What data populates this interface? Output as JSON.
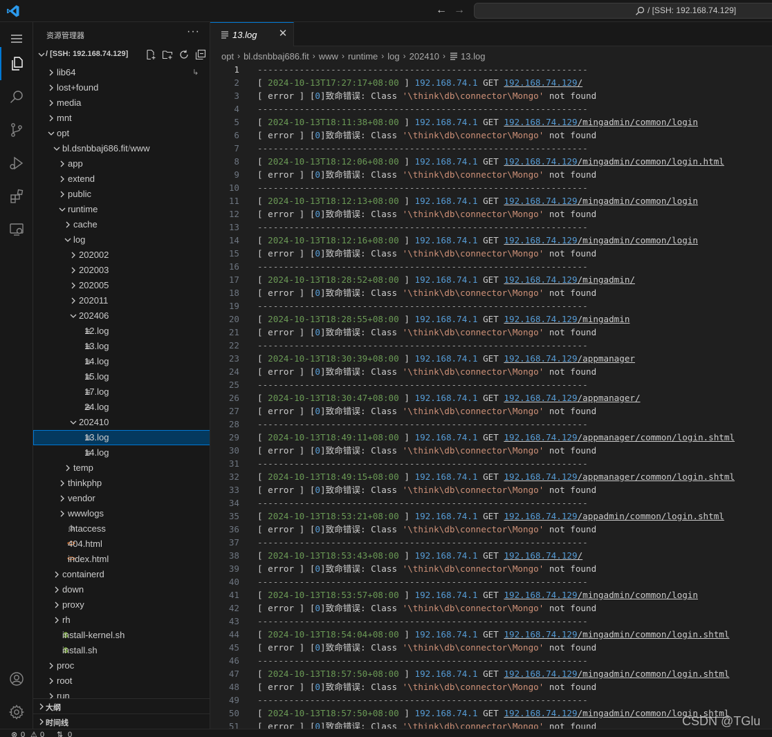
{
  "window": {
    "command_center_text": "/ [SSH: 192.168.74.129]"
  },
  "sidebar": {
    "title": "资源管理器",
    "section_title": "/ [SSH: 192.168.74.129]",
    "outline_title": "大纲",
    "timeline_title": "时间线",
    "tree": [
      {
        "label": "lib64",
        "depth": 0,
        "kind": "folder",
        "open": false,
        "badge": "↳"
      },
      {
        "label": "lost+found",
        "depth": 0,
        "kind": "folder",
        "open": false
      },
      {
        "label": "media",
        "depth": 0,
        "kind": "folder",
        "open": false
      },
      {
        "label": "mnt",
        "depth": 0,
        "kind": "folder",
        "open": false
      },
      {
        "label": "opt",
        "depth": 0,
        "kind": "folder",
        "open": true
      },
      {
        "label": "bl.dsnbbaj686.fit",
        "label2": "www",
        "depth": 1,
        "kind": "folder",
        "open": true
      },
      {
        "label": "app",
        "depth": 2,
        "kind": "folder",
        "open": false
      },
      {
        "label": "extend",
        "depth": 2,
        "kind": "folder",
        "open": false
      },
      {
        "label": "public",
        "depth": 2,
        "kind": "folder",
        "open": false
      },
      {
        "label": "runtime",
        "depth": 2,
        "kind": "folder",
        "open": true
      },
      {
        "label": "cache",
        "depth": 3,
        "kind": "folder",
        "open": false
      },
      {
        "label": "log",
        "depth": 3,
        "kind": "folder",
        "open": true
      },
      {
        "label": "202002",
        "depth": 4,
        "kind": "folder",
        "open": false
      },
      {
        "label": "202003",
        "depth": 4,
        "kind": "folder",
        "open": false
      },
      {
        "label": "202005",
        "depth": 4,
        "kind": "folder",
        "open": false
      },
      {
        "label": "202011",
        "depth": 4,
        "kind": "folder",
        "open": false
      },
      {
        "label": "202406",
        "depth": 4,
        "kind": "folder",
        "open": true
      },
      {
        "label": "12.log",
        "depth": 5,
        "kind": "log"
      },
      {
        "label": "13.log",
        "depth": 5,
        "kind": "log"
      },
      {
        "label": "14.log",
        "depth": 5,
        "kind": "log"
      },
      {
        "label": "15.log",
        "depth": 5,
        "kind": "log"
      },
      {
        "label": "17.log",
        "depth": 5,
        "kind": "log"
      },
      {
        "label": "24.log",
        "depth": 5,
        "kind": "log"
      },
      {
        "label": "202410",
        "depth": 4,
        "kind": "folder",
        "open": true
      },
      {
        "label": "13.log",
        "depth": 5,
        "kind": "log",
        "selected": true
      },
      {
        "label": "14.log",
        "depth": 5,
        "kind": "log"
      },
      {
        "label": "temp",
        "depth": 3,
        "kind": "folder",
        "open": false
      },
      {
        "label": "thinkphp",
        "depth": 2,
        "kind": "folder",
        "open": false
      },
      {
        "label": "vendor",
        "depth": 2,
        "kind": "folder",
        "open": false
      },
      {
        "label": "wwwlogs",
        "depth": 2,
        "kind": "folder",
        "open": false
      },
      {
        "label": ".htaccess",
        "depth": 2,
        "kind": "gear"
      },
      {
        "label": "404.html",
        "depth": 2,
        "kind": "html"
      },
      {
        "label": "index.html",
        "depth": 2,
        "kind": "html"
      },
      {
        "label": "containerd",
        "depth": 1,
        "kind": "folder",
        "open": false
      },
      {
        "label": "down",
        "depth": 1,
        "kind": "folder",
        "open": false
      },
      {
        "label": "proxy",
        "depth": 1,
        "kind": "folder",
        "open": false
      },
      {
        "label": "rh",
        "depth": 1,
        "kind": "folder",
        "open": false
      },
      {
        "label": "install-kernel.sh",
        "depth": 1,
        "kind": "sh"
      },
      {
        "label": "install.sh",
        "depth": 1,
        "kind": "sh"
      },
      {
        "label": "proc",
        "depth": 0,
        "kind": "folder",
        "open": false
      },
      {
        "label": "root",
        "depth": 0,
        "kind": "folder",
        "open": false
      },
      {
        "label": "run",
        "depth": 0,
        "kind": "folder",
        "open": false
      }
    ]
  },
  "editor": {
    "tab_label": "13.log",
    "breadcrumb": [
      "opt",
      "bl.dsnbbaj686.fit",
      "www",
      "runtime",
      "log",
      "202410"
    ],
    "breadcrumb_file": "13.log",
    "dash_line": "---------------------------------------------------------------",
    "client_ip": "192.168.74.1",
    "method": "GET",
    "host": "192.168.74.129",
    "error_prefix": "[ error ] [",
    "error_code": "0",
    "error_mid": "]致命错误: Class ",
    "error_class": "'\\think\\db\\connector\\Mongo'",
    "error_suffix": " not found",
    "entries": [
      {
        "ts": "2024-10-13T17:27:17+08:00",
        "path": "/"
      },
      {
        "ts": "2024-10-13T18:11:38+08:00",
        "path": "/mingadmin/common/login"
      },
      {
        "ts": "2024-10-13T18:12:06+08:00",
        "path": "/mingadmin/common/login.html"
      },
      {
        "ts": "2024-10-13T18:12:13+08:00",
        "path": "/mingadmin/common/login"
      },
      {
        "ts": "2024-10-13T18:12:16+08:00",
        "path": "/mingadmin/common/login"
      },
      {
        "ts": "2024-10-13T18:28:52+08:00",
        "path": "/mingadmin/"
      },
      {
        "ts": "2024-10-13T18:28:55+08:00",
        "path": "/mingadmin"
      },
      {
        "ts": "2024-10-13T18:30:39+08:00",
        "path": "/appmanager"
      },
      {
        "ts": "2024-10-13T18:30:47+08:00",
        "path": "/appmanager/"
      },
      {
        "ts": "2024-10-13T18:49:11+08:00",
        "path": "/appmanager/common/login.shtml"
      },
      {
        "ts": "2024-10-13T18:49:15+08:00",
        "path": "/appmanager/common/login.shtml"
      },
      {
        "ts": "2024-10-13T18:53:21+08:00",
        "path": "/appadmin/common/login.shtml"
      },
      {
        "ts": "2024-10-13T18:53:43+08:00",
        "path": "/"
      },
      {
        "ts": "2024-10-13T18:53:57+08:00",
        "path": "/mingadmin/common/login"
      },
      {
        "ts": "2024-10-13T18:54:04+08:00",
        "path": "/mingadmin/common/login.shtml"
      },
      {
        "ts": "2024-10-13T18:57:50+08:00",
        "path": "/mingadmin/common/login.shtml"
      },
      {
        "ts": "2024-10-13T18:57:50+08:00",
        "path": "/mingadmin/common/login.shtml"
      }
    ]
  },
  "statusbar": {
    "errors": "0",
    "warnings": "0",
    "ports": "0"
  },
  "watermark": "CSDN @TGlu",
  "colors": {
    "accent": "#0078d4",
    "timestamp": "#6a9955",
    "ip": "#569cd6",
    "string": "#ce9178"
  }
}
